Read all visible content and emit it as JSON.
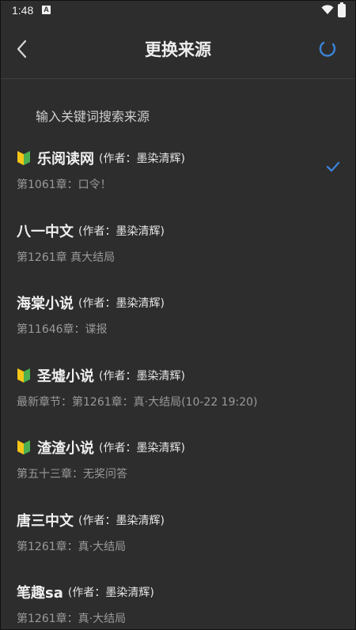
{
  "status_bar": {
    "time": "1:48",
    "notif_glyph": "A"
  },
  "toolbar": {
    "title": "更换来源",
    "back_icon": "chevron-left-icon",
    "refresh_icon": "refresh-spinner-icon"
  },
  "search": {
    "placeholder": "输入关键词搜索来源",
    "value": ""
  },
  "colors": {
    "background": "#2d2d2d",
    "accent": "#3b82d6",
    "badge_green": "#4caf50",
    "badge_yellow": "#f5c518"
  },
  "sources": [
    {
      "name": "乐阅读网",
      "author": "(作者：墨染清辉)",
      "chapter": "第1061章：口令！",
      "badge": true,
      "selected": true
    },
    {
      "name": "八一中文",
      "author": "(作者：墨染清辉)",
      "chapter": "第1261章 真大结局",
      "badge": false,
      "selected": false
    },
    {
      "name": "海棠小说",
      "author": "(作者：墨染清辉)",
      "chapter": "第11646章：谍报",
      "badge": false,
      "selected": false
    },
    {
      "name": "圣墟小说",
      "author": "(作者：墨染清辉)",
      "chapter": "最新章节：第1261章：真·大结局(10-22 19:20)",
      "badge": true,
      "selected": false
    },
    {
      "name": "渣渣小说",
      "author": "(作者：墨染清辉)",
      "chapter": "第五十三章：无奖问答",
      "badge": true,
      "selected": false
    },
    {
      "name": "唐三中文",
      "author": "(作者：墨染清辉)",
      "chapter": "第1261章：真·大结局",
      "badge": false,
      "selected": false
    },
    {
      "name": "笔趣sa",
      "author": "(作者：墨染清辉)",
      "chapter": "第1261章：真·大结局",
      "badge": false,
      "selected": false
    }
  ]
}
